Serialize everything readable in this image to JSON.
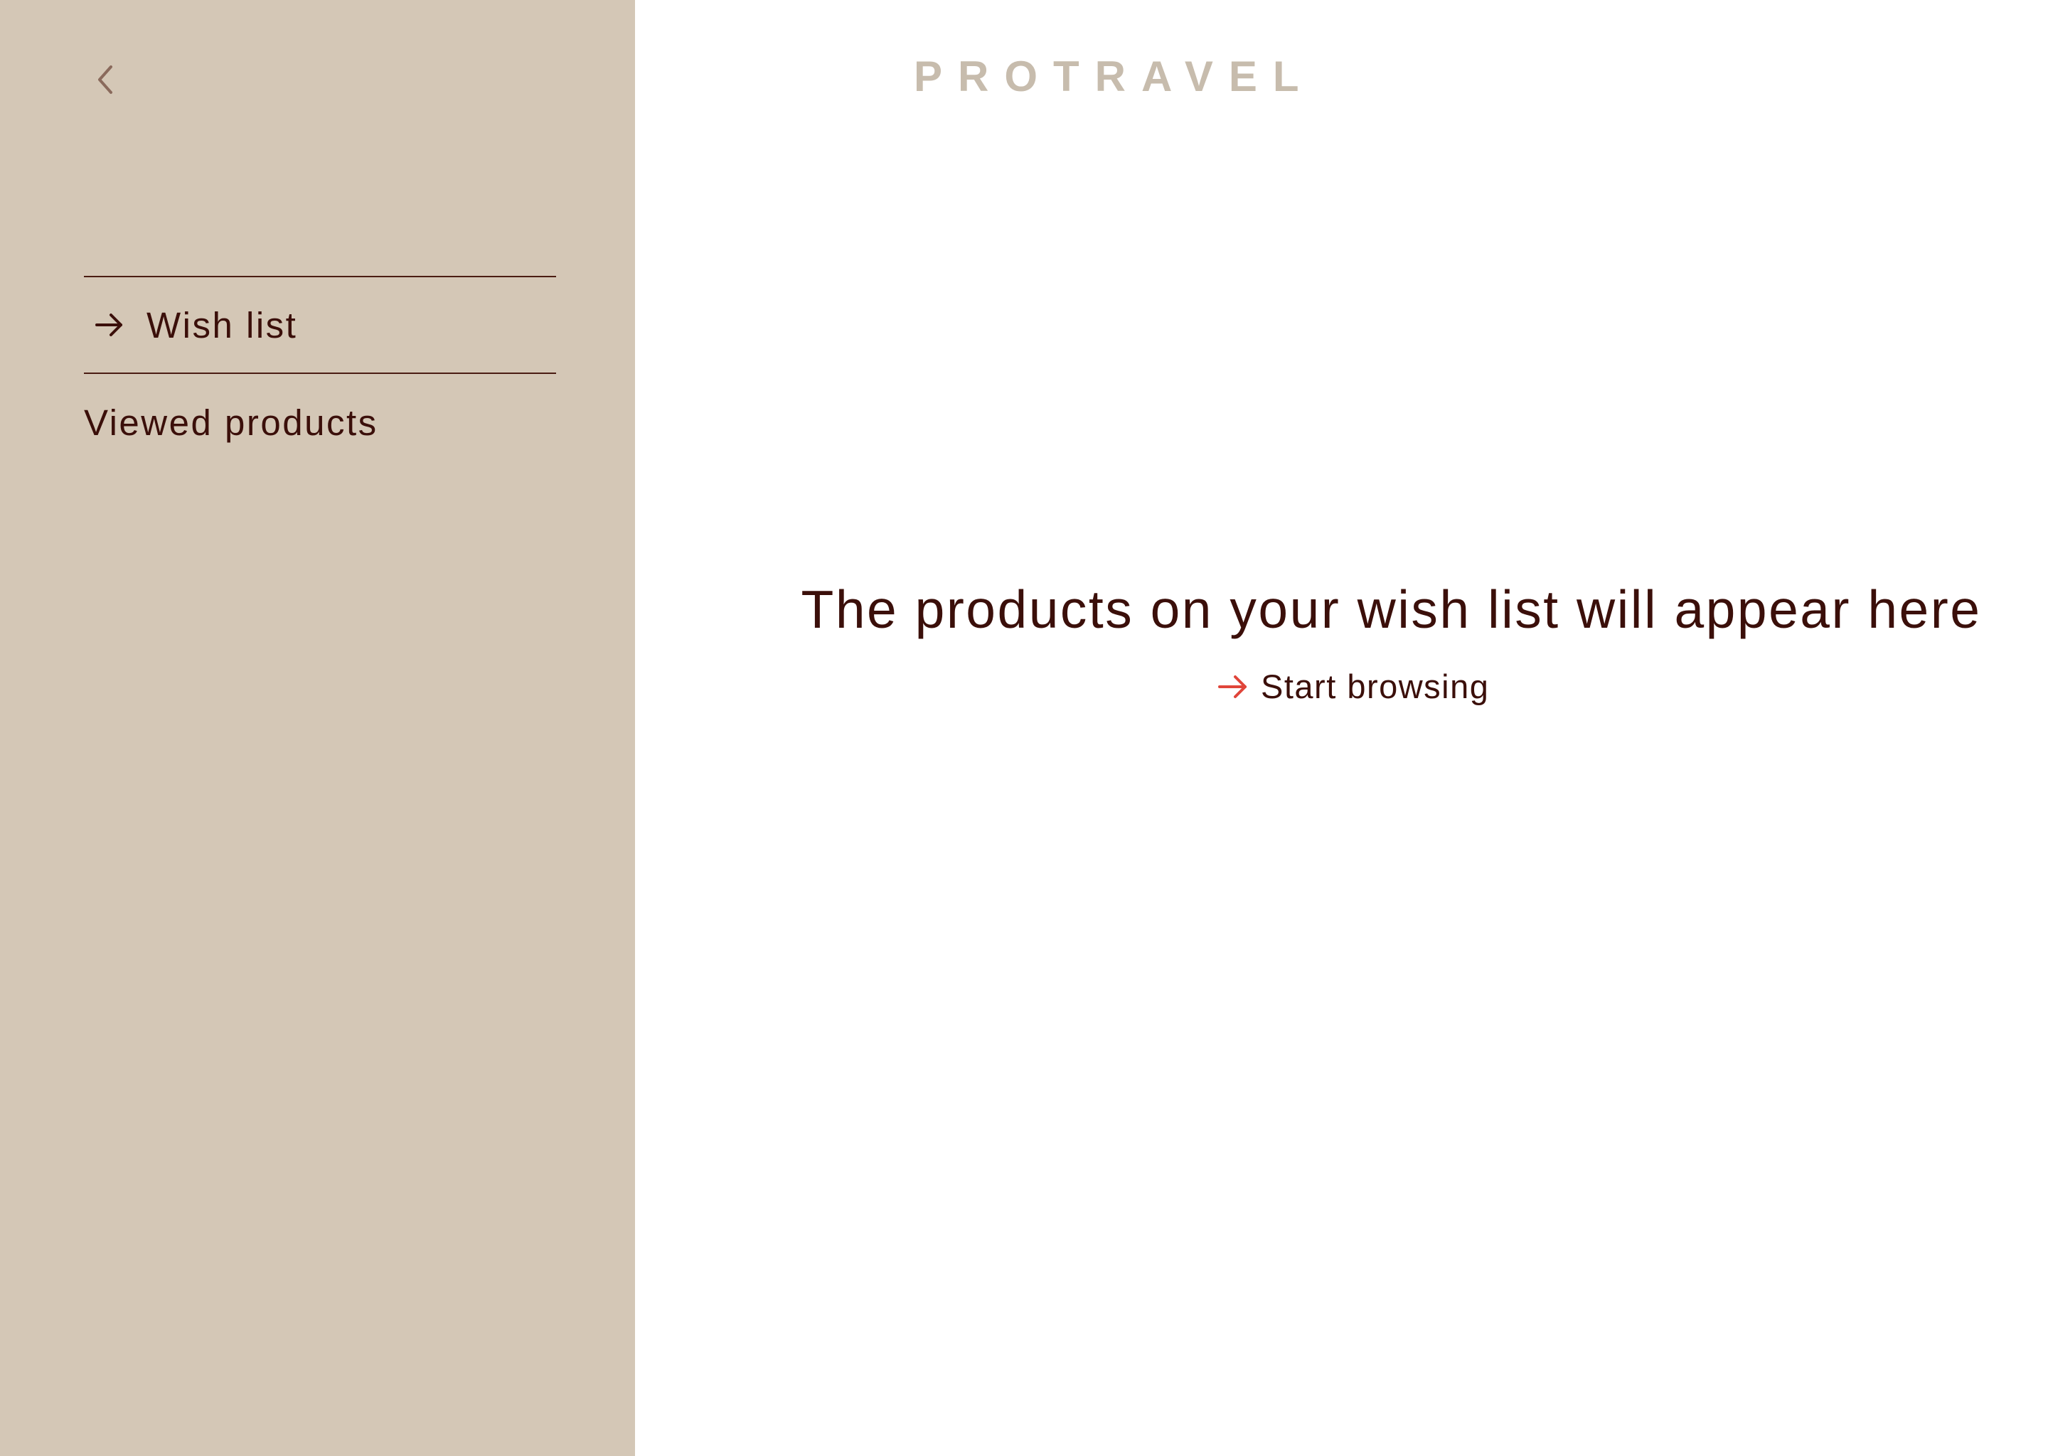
{
  "app": {
    "brand": "PROTRAVEL"
  },
  "sidebar": {
    "back_icon": "chevron-left-icon",
    "items": [
      {
        "label": "Wish list",
        "active": true,
        "icon": "arrow-right-icon"
      },
      {
        "label": "Viewed products",
        "active": false
      }
    ]
  },
  "main": {
    "empty_title": "The products on your wish list will appear here",
    "cta_label": "Start browsing",
    "cta_icon": "arrow-right-icon"
  },
  "colors": {
    "sidebar_bg": "#d4c7b6",
    "text_dark": "#3b0f0a",
    "brand": "#c7bcad",
    "accent": "#e0453a",
    "back_icon": "#8a6a5c"
  }
}
